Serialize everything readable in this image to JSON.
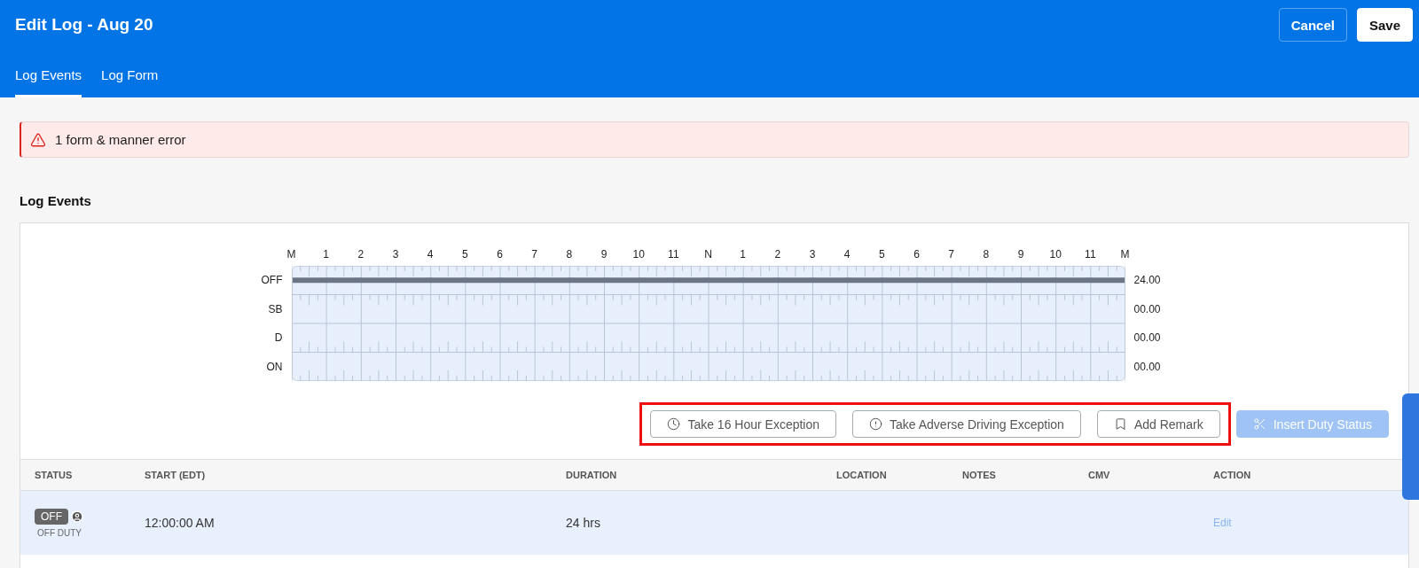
{
  "header": {
    "title": "Edit Log - Aug 20",
    "buttons": [
      {
        "label": "Cancel",
        "kind": "outline"
      },
      {
        "label": "Save",
        "kind": "solid"
      }
    ]
  },
  "tabs": [
    {
      "label": "Log Events",
      "selected": true
    },
    {
      "label": "Log Form",
      "selected": false
    }
  ],
  "alert": {
    "message": "1 form & manner error"
  },
  "section_title": "Log Events",
  "log_graph": {
    "hours": [
      "M",
      "1",
      "2",
      "3",
      "4",
      "5",
      "6",
      "7",
      "8",
      "9",
      "10",
      "11",
      "N",
      "1",
      "2",
      "3",
      "4",
      "5",
      "6",
      "7",
      "8",
      "9",
      "10",
      "11",
      "M"
    ],
    "rows": [
      {
        "label": "OFF",
        "total": "24.00",
        "active": true
      },
      {
        "label": "SB",
        "total": "00.00",
        "active": false
      },
      {
        "label": "D",
        "total": "00.00",
        "active": false
      },
      {
        "label": "ON",
        "total": "00.00",
        "active": false
      }
    ]
  },
  "actions": [
    {
      "label": "Take 16 Hour Exception",
      "kind": "clock",
      "highlighted": true,
      "disabled": false
    },
    {
      "label": "Take Adverse Driving Exception",
      "kind": "alert",
      "highlighted": true,
      "disabled": false
    },
    {
      "label": "Add Remark",
      "kind": "bookmark",
      "highlighted": true,
      "disabled": false
    },
    {
      "label": "Insert Duty Status",
      "kind": "scissors",
      "highlighted": false,
      "disabled": true
    }
  ],
  "table": {
    "columns": [
      "STATUS",
      "START (EDT)",
      "DURATION",
      "LOCATION",
      "NOTES",
      "CMV",
      "ACTION"
    ],
    "rows": [
      {
        "status_badge": "OFF",
        "status_text": "OFF DUTY",
        "start": "12:00:00 AM",
        "duration": "24 hrs",
        "action": "Edit",
        "selected": true
      }
    ]
  }
}
